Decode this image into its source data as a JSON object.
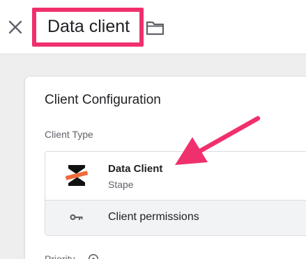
{
  "header": {
    "title": "Data client",
    "close_icon": "close-icon",
    "folder_icon": "folder-icon",
    "highlight_color": "#f0306c"
  },
  "config": {
    "heading": "Client Configuration",
    "client_type_label": "Client Type",
    "client": {
      "name": "Data Client",
      "vendor": "Stape",
      "logo_icon": "stape-logo-icon"
    },
    "permissions": {
      "label": "Client permissions",
      "icon": "key-icon"
    },
    "priority_label": "Priority",
    "priority_help_icon": "help-icon"
  },
  "annotation": {
    "arrow_color": "#f0306c"
  }
}
